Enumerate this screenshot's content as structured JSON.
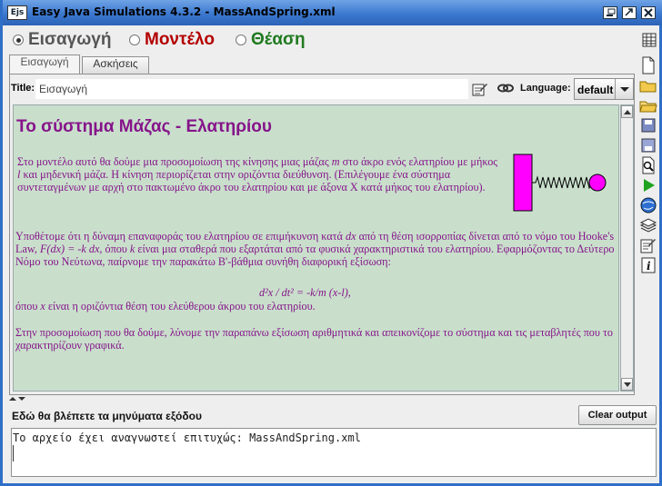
{
  "window": {
    "title": "Easy Java Simulations 4.3.2 - MassAndSpring.xml",
    "app_icon": "Ejs"
  },
  "modes": [
    {
      "label": "Εισαγωγή",
      "selected": true,
      "color": "#555555"
    },
    {
      "label": "Μοντέλο",
      "selected": false,
      "color": "#B40000"
    },
    {
      "label": "Θέαση",
      "selected": false,
      "color": "#1F7A1F"
    }
  ],
  "tabs": [
    {
      "label": "Εισαγωγή",
      "active": true
    },
    {
      "label": "Ασκήσεις",
      "active": false
    }
  ],
  "page_title": {
    "label": "Title:",
    "value": "Εισαγωγή"
  },
  "language": {
    "label": "Language:",
    "value": "default"
  },
  "content": {
    "heading": "Το σύστημα Μάζας - Ελατηρίου",
    "p1": {
      "a": "Στο μοντέλο αυτό θα δούμε μια προσομοίωση της κίνησης μιας μάζας ",
      "m": "m",
      "b": " στο άκρο ενός ελατηρίου με μήκος ",
      "l": "l",
      "c": " και μηδενική μάζα. Η κίνηση περιορίζεται στην οριζόντια διεύθυνση. (Επιλέγουμε ένα σύστημα συντεταγμένων με αρχή στο πακτωμένο άκρο του ελατηρίου και με άξονα X κατά μήκος του ελατηρίου)."
    },
    "p2": {
      "a": "Υποθέτομε ότι η δύναμη επαναφοράς του ελατηρίου σε επιμήκυνση κατά ",
      "dx": "dx",
      "b": " από τη θέση ισορροπίας δίνεται από το νόμο του Hooke's Law, ",
      "f": "F(dx) =  -k dx",
      "c": ", όπου ",
      "k": "k",
      "d": " είναι μια σταθερά που εξαρτάται από τα φυσικά χαρακτηριστικά του ελατηρίου. Εφαρμόζοντας το Δεύτερο Νόμο του Νεύτωνα, παίρνομε την παρακάτω Β'-βάθμια συνήθη διαφορική εξίσωση:"
    },
    "equation": "d²x / dt² = -k/m (x-l),",
    "p4": {
      "a": "όπου ",
      "x": "x",
      "b": " είναι η οριζόντια θέση του ελεύθερου άκρου του ελατηρίου."
    },
    "p5": "Στην προσομοίωση που θα δούμε, λύνομε την παραπάνω εξίσωση αριθμητικά και απεικονίζομε το σύστημα και τις μεταβλητές που το χαρακτηρίζουν γραφικά.",
    "background": "#C9DFCC",
    "text_color": "#86148A"
  },
  "output": {
    "title": "Εδώ θα βλέπετε τα μηνύματα εξόδου",
    "clear_label": "Clear output",
    "message": "Το αρχείο έχει αναγνωστεί επιτυχώς: MassAndSpring.xml"
  },
  "toolbar_icons": [
    "new-icon",
    "open-icon",
    "folder-icon",
    "save-icon",
    "save-as-icon",
    "search-icon",
    "run-icon",
    "web-icon",
    "layers-icon",
    "edit-icon",
    "info-icon"
  ]
}
